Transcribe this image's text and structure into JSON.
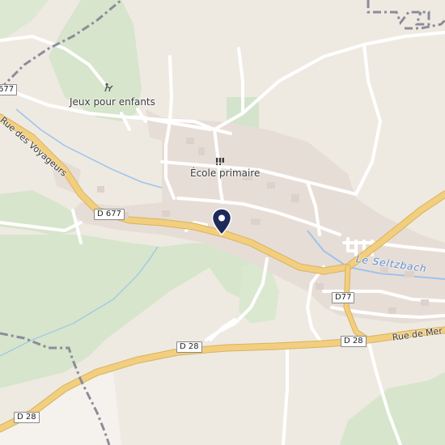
{
  "map": {
    "poi": {
      "playground": {
        "label": "Jeux pour enfants",
        "icon": "playground-icon"
      },
      "school": {
        "label": "École primaire",
        "icon": "school-icon"
      }
    },
    "roads": {
      "d677_west": "677",
      "d677": "D 677",
      "d77": "D77",
      "d28_center": "D 28",
      "d28_east": "D 28",
      "d28_southwest": "D 28"
    },
    "streets": {
      "rue_des_voyageurs": "Rue des Voyageurs",
      "rue_de_mer": "Rue de Mer"
    },
    "water": {
      "stream": "Le Seltzbach"
    },
    "marker": {
      "icon": "location-pin-icon",
      "color": "#1e2a5a"
    },
    "colors": {
      "background": "#eeeae2",
      "forest": "#d6e5cb",
      "main_road": "#f2cf7e",
      "minor_road": "#ffffff",
      "water": "#9cc4ea",
      "boundary": "#8c8c99",
      "built_area": "#e7ddd7",
      "field": "#f5f2ed"
    }
  }
}
